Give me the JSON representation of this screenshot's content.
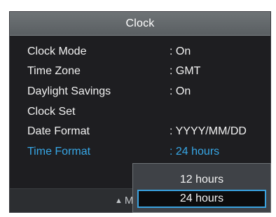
{
  "title": "Clock",
  "menu": [
    {
      "label": "Clock Mode",
      "value": ": On"
    },
    {
      "label": "Time Zone",
      "value": ": GMT"
    },
    {
      "label": "Daylight Savings",
      "value": ": On"
    },
    {
      "label": "Clock Set",
      "value": ""
    },
    {
      "label": "Date Format",
      "value": ": YYYY/MM/DD"
    },
    {
      "label": "Time Format",
      "value": ": 24 hours"
    }
  ],
  "dropdown": {
    "options": [
      "12 hours",
      "24 hours"
    ],
    "selected": "24 hours"
  },
  "bottom_bar": {
    "icon": "up-down-arrow-icon",
    "hint_prefix": "M"
  },
  "colors": {
    "accent": "#37a7e6",
    "panel_bg": "#1e1e21",
    "title_bg": "#666b6e",
    "dropdown_bg": "#3f4247"
  }
}
